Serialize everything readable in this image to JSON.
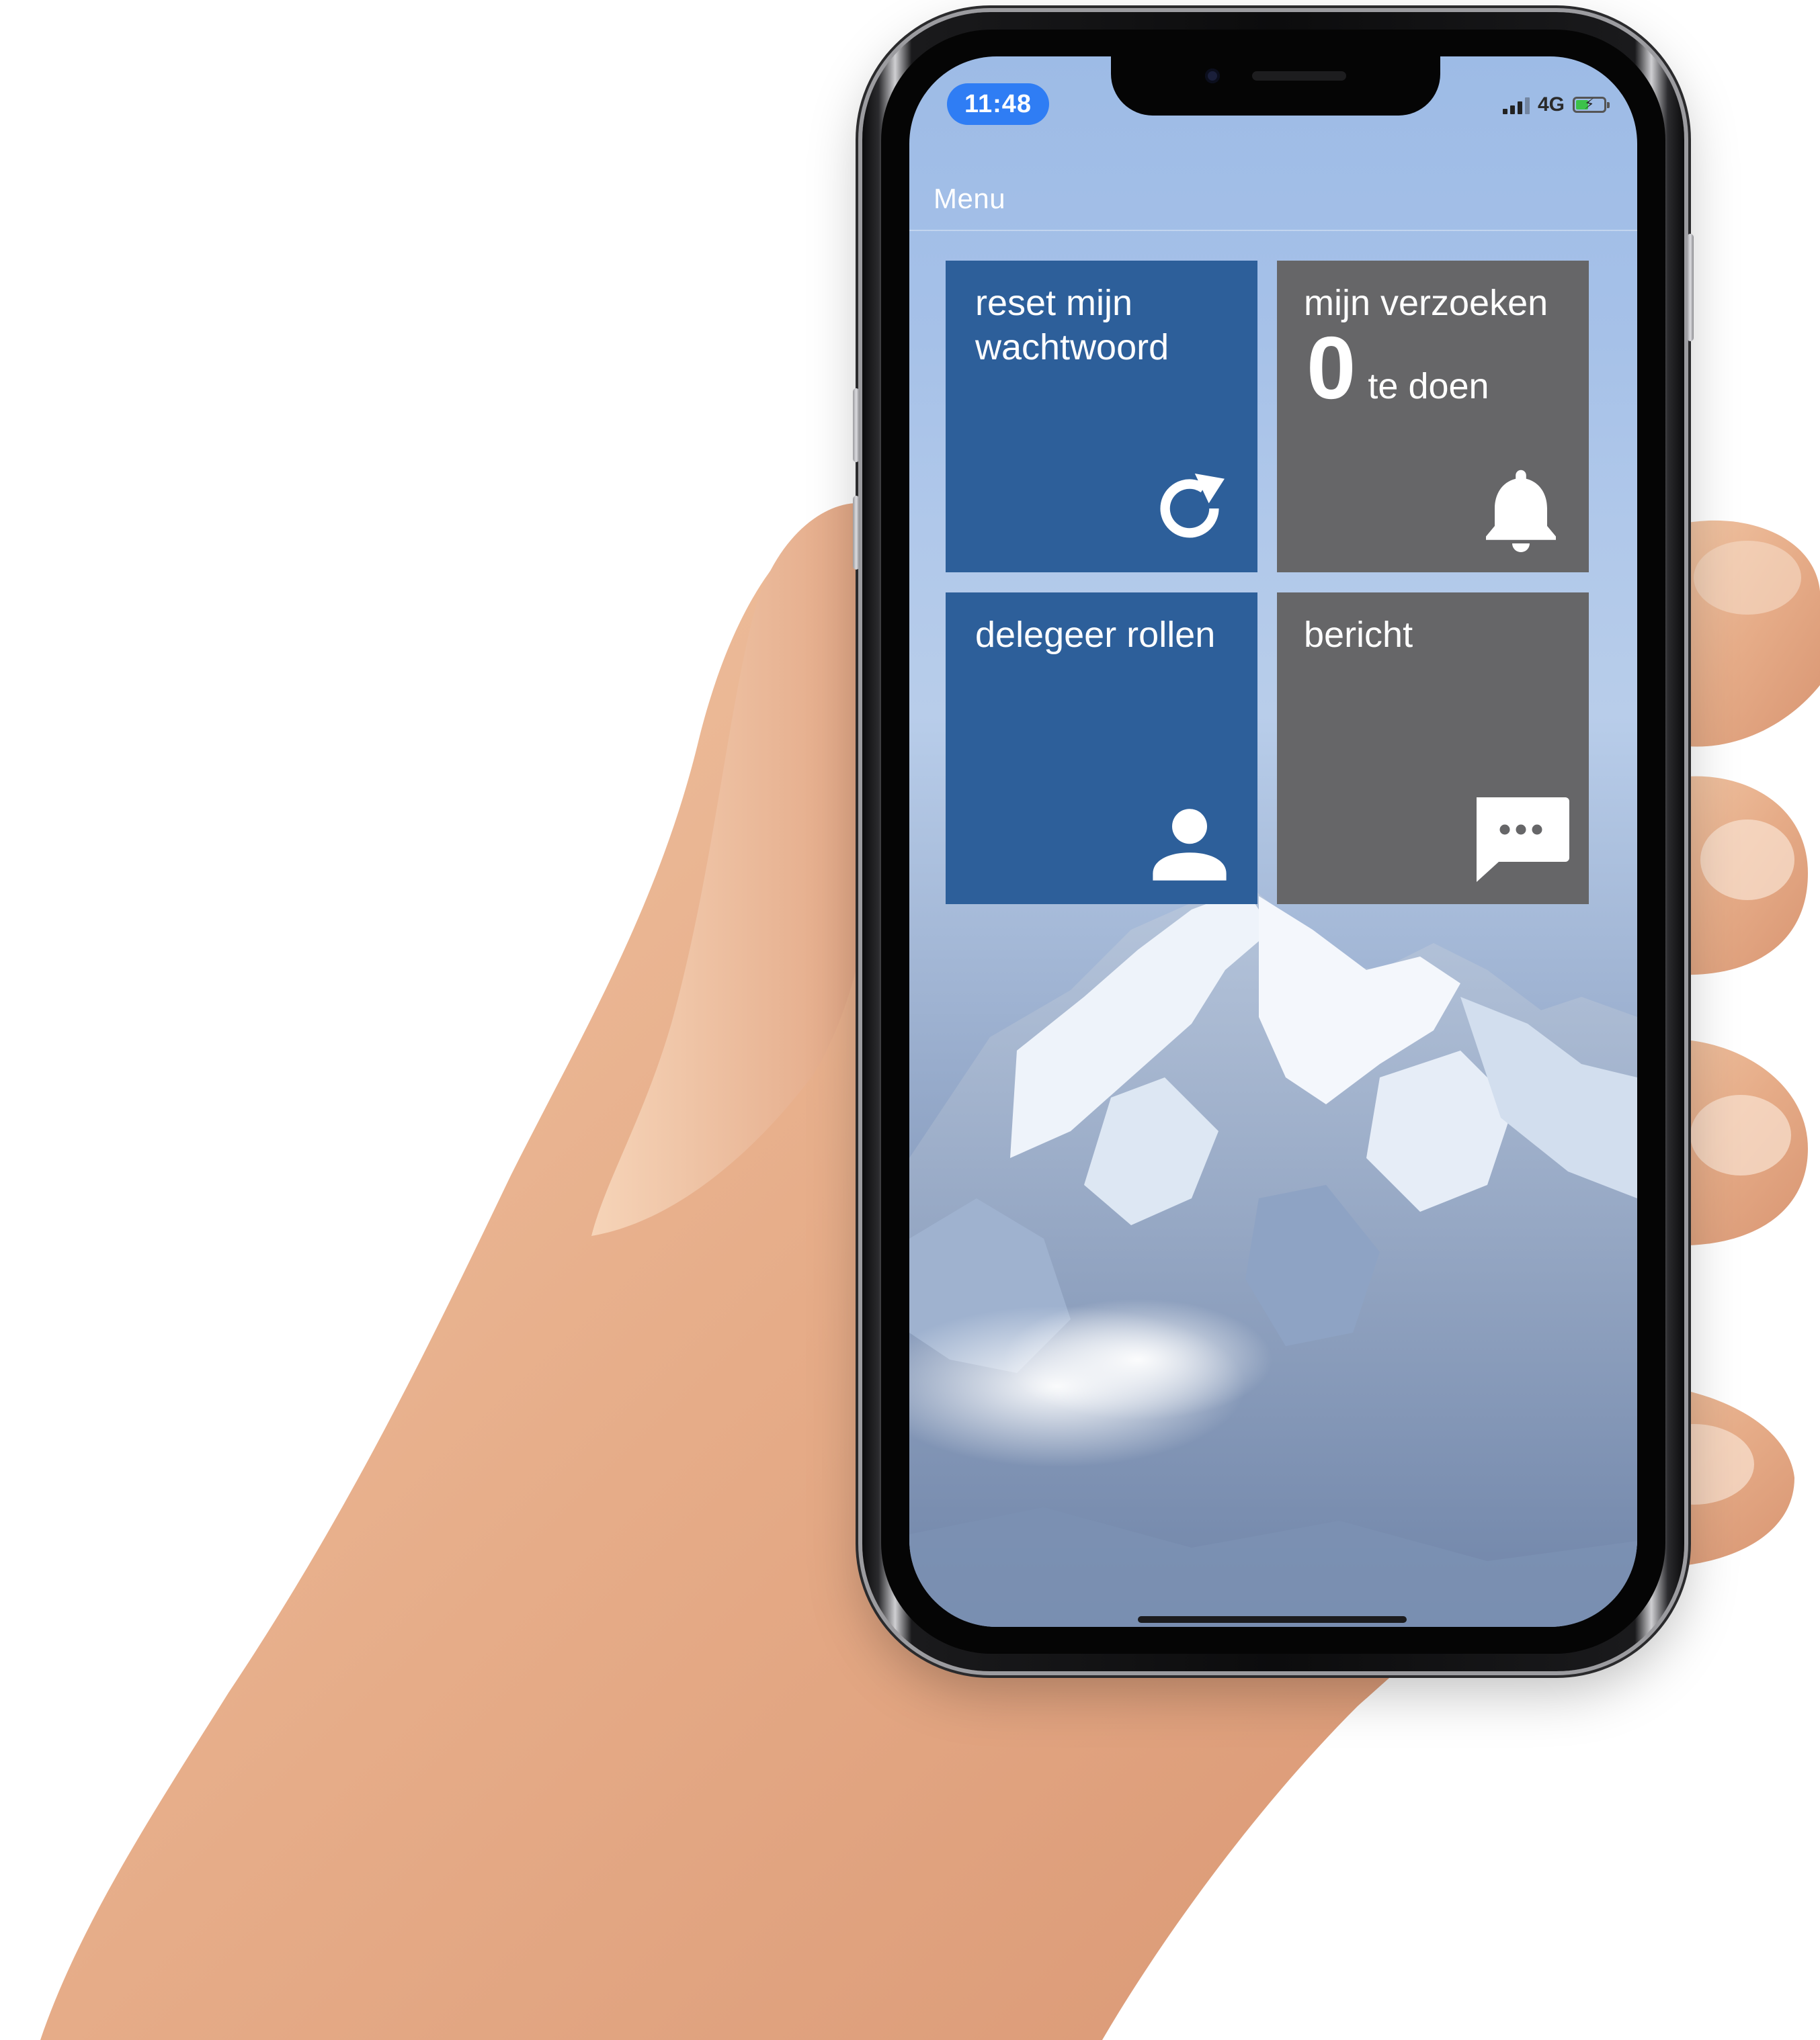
{
  "status_bar": {
    "time": "11:48",
    "network": "4G",
    "signal_icon": "signal-bars-icon",
    "battery_icon": "battery-charging-icon",
    "battery_color": "#3cc24a",
    "time_pill_color": "#2f7df4"
  },
  "header": {
    "menu_label": "Menu"
  },
  "tiles": [
    {
      "label": "reset mijn wachtwoord",
      "icon": "refresh-icon",
      "color": "#2d5f9a"
    },
    {
      "label": "mijn verzoeken",
      "count": "0",
      "count_unit": "te doen",
      "icon": "bell-icon",
      "color": "#666668"
    },
    {
      "label": "delegeer rollen",
      "icon": "person-icon",
      "color": "#2d5f9a"
    },
    {
      "label": "bericht",
      "icon": "message-icon",
      "color": "#666668"
    }
  ]
}
